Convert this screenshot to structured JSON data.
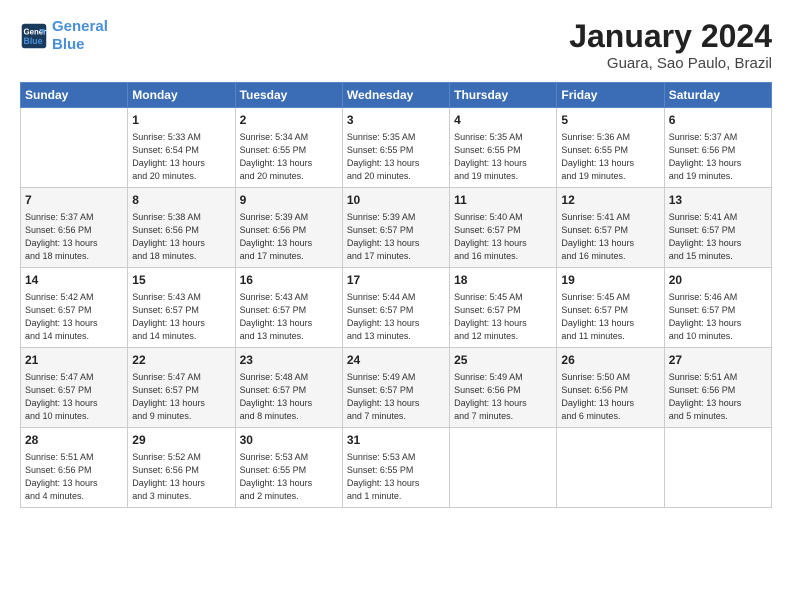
{
  "header": {
    "logo_line1": "General",
    "logo_line2": "Blue",
    "title": "January 2024",
    "subtitle": "Guara, Sao Paulo, Brazil"
  },
  "columns": [
    "Sunday",
    "Monday",
    "Tuesday",
    "Wednesday",
    "Thursday",
    "Friday",
    "Saturday"
  ],
  "weeks": [
    [
      {
        "day": "",
        "info": ""
      },
      {
        "day": "1",
        "info": "Sunrise: 5:33 AM\nSunset: 6:54 PM\nDaylight: 13 hours\nand 20 minutes."
      },
      {
        "day": "2",
        "info": "Sunrise: 5:34 AM\nSunset: 6:55 PM\nDaylight: 13 hours\nand 20 minutes."
      },
      {
        "day": "3",
        "info": "Sunrise: 5:35 AM\nSunset: 6:55 PM\nDaylight: 13 hours\nand 20 minutes."
      },
      {
        "day": "4",
        "info": "Sunrise: 5:35 AM\nSunset: 6:55 PM\nDaylight: 13 hours\nand 19 minutes."
      },
      {
        "day": "5",
        "info": "Sunrise: 5:36 AM\nSunset: 6:55 PM\nDaylight: 13 hours\nand 19 minutes."
      },
      {
        "day": "6",
        "info": "Sunrise: 5:37 AM\nSunset: 6:56 PM\nDaylight: 13 hours\nand 19 minutes."
      }
    ],
    [
      {
        "day": "7",
        "info": "Sunrise: 5:37 AM\nSunset: 6:56 PM\nDaylight: 13 hours\nand 18 minutes."
      },
      {
        "day": "8",
        "info": "Sunrise: 5:38 AM\nSunset: 6:56 PM\nDaylight: 13 hours\nand 18 minutes."
      },
      {
        "day": "9",
        "info": "Sunrise: 5:39 AM\nSunset: 6:56 PM\nDaylight: 13 hours\nand 17 minutes."
      },
      {
        "day": "10",
        "info": "Sunrise: 5:39 AM\nSunset: 6:57 PM\nDaylight: 13 hours\nand 17 minutes."
      },
      {
        "day": "11",
        "info": "Sunrise: 5:40 AM\nSunset: 6:57 PM\nDaylight: 13 hours\nand 16 minutes."
      },
      {
        "day": "12",
        "info": "Sunrise: 5:41 AM\nSunset: 6:57 PM\nDaylight: 13 hours\nand 16 minutes."
      },
      {
        "day": "13",
        "info": "Sunrise: 5:41 AM\nSunset: 6:57 PM\nDaylight: 13 hours\nand 15 minutes."
      }
    ],
    [
      {
        "day": "14",
        "info": "Sunrise: 5:42 AM\nSunset: 6:57 PM\nDaylight: 13 hours\nand 14 minutes."
      },
      {
        "day": "15",
        "info": "Sunrise: 5:43 AM\nSunset: 6:57 PM\nDaylight: 13 hours\nand 14 minutes."
      },
      {
        "day": "16",
        "info": "Sunrise: 5:43 AM\nSunset: 6:57 PM\nDaylight: 13 hours\nand 13 minutes."
      },
      {
        "day": "17",
        "info": "Sunrise: 5:44 AM\nSunset: 6:57 PM\nDaylight: 13 hours\nand 13 minutes."
      },
      {
        "day": "18",
        "info": "Sunrise: 5:45 AM\nSunset: 6:57 PM\nDaylight: 13 hours\nand 12 minutes."
      },
      {
        "day": "19",
        "info": "Sunrise: 5:45 AM\nSunset: 6:57 PM\nDaylight: 13 hours\nand 11 minutes."
      },
      {
        "day": "20",
        "info": "Sunrise: 5:46 AM\nSunset: 6:57 PM\nDaylight: 13 hours\nand 10 minutes."
      }
    ],
    [
      {
        "day": "21",
        "info": "Sunrise: 5:47 AM\nSunset: 6:57 PM\nDaylight: 13 hours\nand 10 minutes."
      },
      {
        "day": "22",
        "info": "Sunrise: 5:47 AM\nSunset: 6:57 PM\nDaylight: 13 hours\nand 9 minutes."
      },
      {
        "day": "23",
        "info": "Sunrise: 5:48 AM\nSunset: 6:57 PM\nDaylight: 13 hours\nand 8 minutes."
      },
      {
        "day": "24",
        "info": "Sunrise: 5:49 AM\nSunset: 6:57 PM\nDaylight: 13 hours\nand 7 minutes."
      },
      {
        "day": "25",
        "info": "Sunrise: 5:49 AM\nSunset: 6:56 PM\nDaylight: 13 hours\nand 7 minutes."
      },
      {
        "day": "26",
        "info": "Sunrise: 5:50 AM\nSunset: 6:56 PM\nDaylight: 13 hours\nand 6 minutes."
      },
      {
        "day": "27",
        "info": "Sunrise: 5:51 AM\nSunset: 6:56 PM\nDaylight: 13 hours\nand 5 minutes."
      }
    ],
    [
      {
        "day": "28",
        "info": "Sunrise: 5:51 AM\nSunset: 6:56 PM\nDaylight: 13 hours\nand 4 minutes."
      },
      {
        "day": "29",
        "info": "Sunrise: 5:52 AM\nSunset: 6:56 PM\nDaylight: 13 hours\nand 3 minutes."
      },
      {
        "day": "30",
        "info": "Sunrise: 5:53 AM\nSunset: 6:55 PM\nDaylight: 13 hours\nand 2 minutes."
      },
      {
        "day": "31",
        "info": "Sunrise: 5:53 AM\nSunset: 6:55 PM\nDaylight: 13 hours\nand 1 minute."
      },
      {
        "day": "",
        "info": ""
      },
      {
        "day": "",
        "info": ""
      },
      {
        "day": "",
        "info": ""
      }
    ]
  ]
}
